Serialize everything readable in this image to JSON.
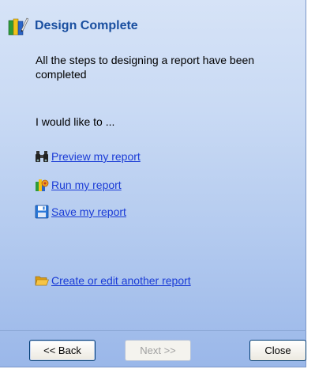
{
  "dialog": {
    "title": "Design Complete",
    "intro": "All the steps to designing a report have been completed",
    "prompt": "I would like to ..."
  },
  "links": [
    {
      "label": "Preview my report",
      "icon": "binoculars-icon"
    },
    {
      "label": "Run my report",
      "icon": "run-report-icon"
    },
    {
      "label": "Save my report",
      "icon": "floppy-disk-icon"
    },
    {
      "label": "Create or edit another report",
      "icon": "folder-open-icon"
    }
  ],
  "buttons": {
    "back": "<< Back",
    "next": "Next >>",
    "close": "Close"
  },
  "colors": {
    "title": "#1a4fa0",
    "link": "#1a3bd6",
    "panel_top": "#d6e3f7",
    "panel_bottom": "#9ab7e9"
  }
}
